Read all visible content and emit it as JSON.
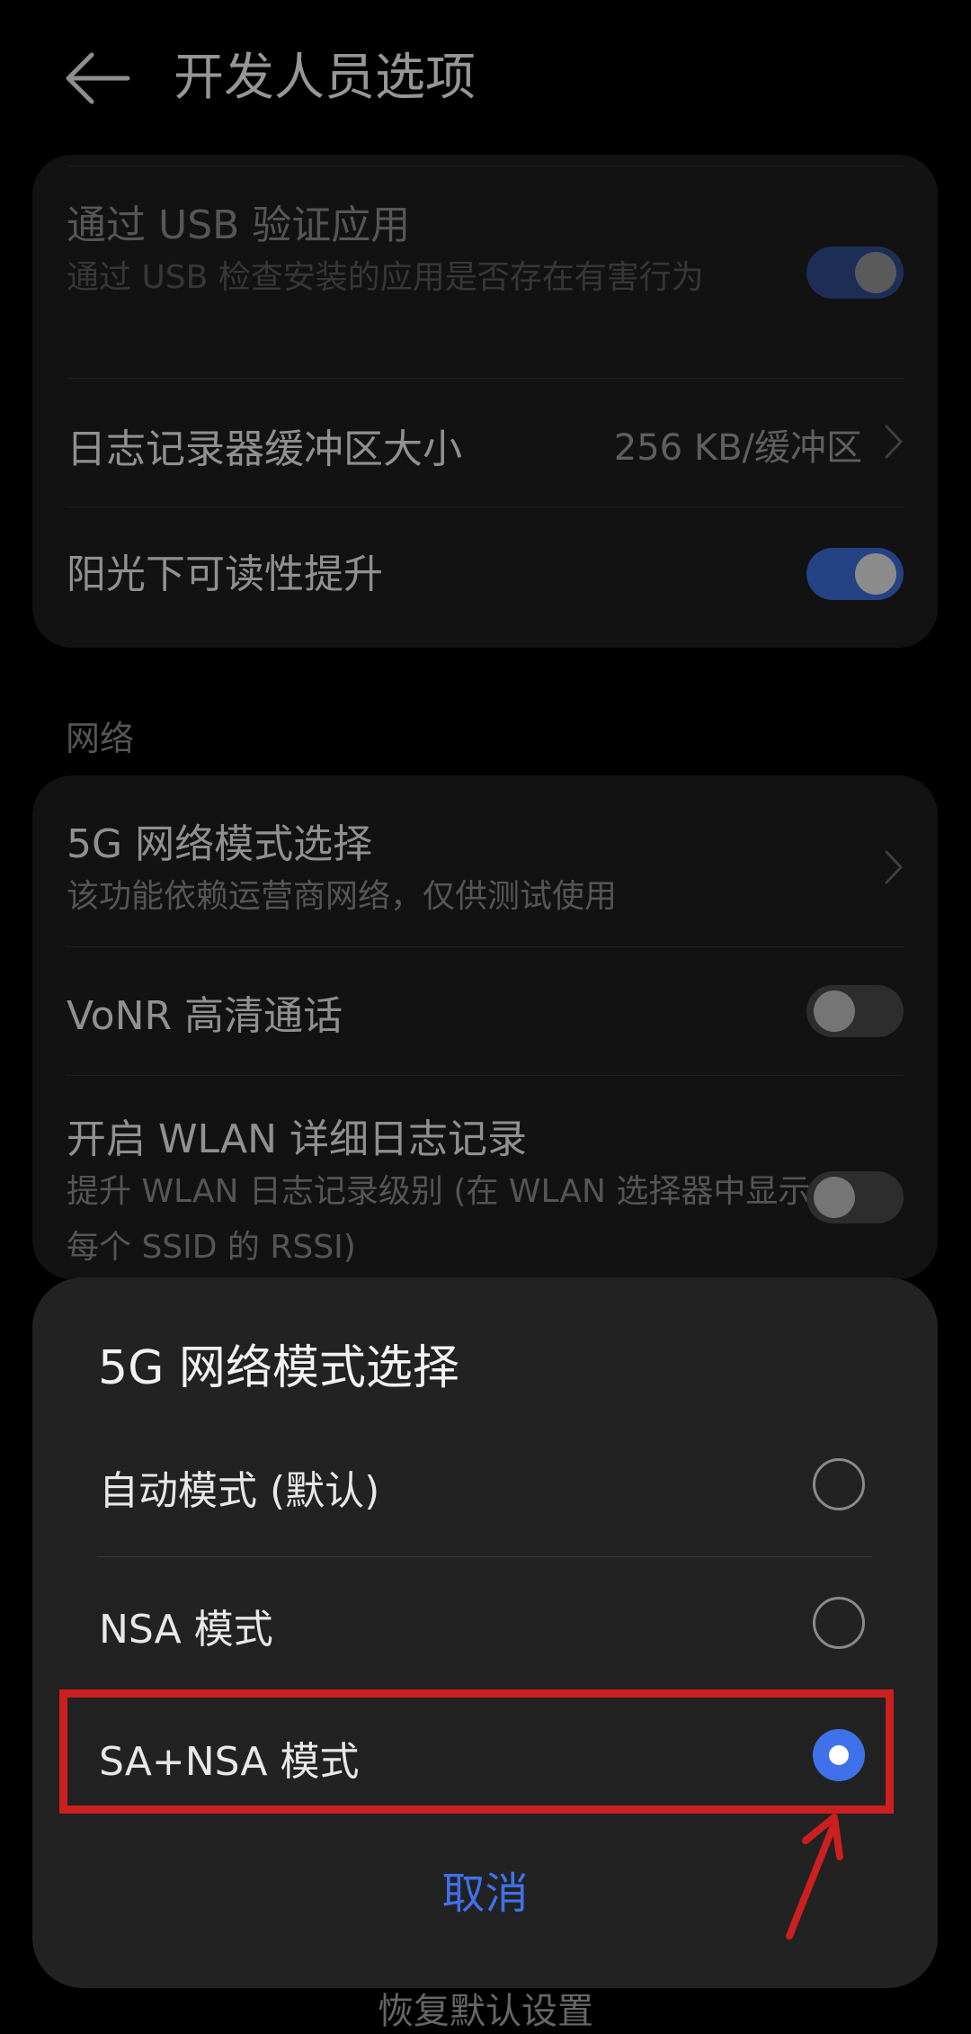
{
  "header": {
    "title": "开发人员选项"
  },
  "top_card": {
    "rows": [
      {
        "title": "通过 USB 验证应用",
        "subtitle": "通过 USB 检查安装的应用是否存在有害行为",
        "toggle": "on",
        "disabled": true
      },
      {
        "title": "日志记录器缓冲区大小",
        "value": "256 KB/缓冲区"
      },
      {
        "title": "阳光下可读性提升",
        "toggle": "on"
      }
    ]
  },
  "network_section": {
    "label": "网络",
    "rows": [
      {
        "title": "5G 网络模式选择",
        "subtitle": "该功能依赖运营商网络，仅供测试使用"
      },
      {
        "title": "VoNR 高清通话",
        "toggle": "off"
      },
      {
        "title": "开启 WLAN 详细日志记录",
        "subtitle": "提升 WLAN 日志记录级别 (在 WLAN 选择器中显示每个 SSID 的 RSSI)",
        "toggle": "off"
      }
    ]
  },
  "dialog": {
    "title": "5G 网络模式选择",
    "options": [
      {
        "label": "自动模式 (默认)",
        "selected": false
      },
      {
        "label": "NSA 模式",
        "selected": false
      },
      {
        "label": "SA+NSA 模式",
        "selected": true
      }
    ],
    "cancel_label": "取消"
  },
  "bottom_text": "恢复默认设置",
  "colors": {
    "accent": "#3f72ea",
    "annotation": "#cc1f1f",
    "background": "#000000",
    "card": "#1d1d1d",
    "dialog": "#222222"
  },
  "icons": {
    "back": "back-arrow-icon",
    "chevron": "chevron-right-icon",
    "annotation_arrow": "red-arrow-annotation"
  }
}
